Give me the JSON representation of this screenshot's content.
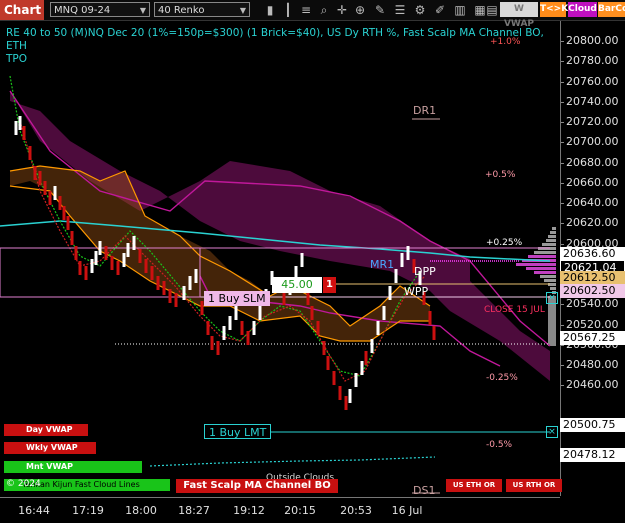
{
  "toolbar": {
    "tab_label": "Chart",
    "instrument": "MNQ 09-24",
    "bar_type": "40 Renko",
    "buttons": {
      "vwap": "W VWAP",
      "tk": "T<>K",
      "cloud": "Cloud",
      "barco": "BarCo"
    },
    "icons": [
      "bar-chart-icon",
      "candle-icon",
      "bar-type-icon",
      "magnify-icon",
      "crosshair-icon",
      "zoom-icon",
      "draw-icon",
      "properties-icon",
      "strategy-icon",
      "pencil-icon",
      "bars-icon",
      "chart-trader-icon",
      "grid-icon"
    ]
  },
  "chart": {
    "title": "RE 40 to 50 (M)NQ Dec 20 (1%=150p=$300) (1 Brick=$40), US Dy RTH %, Fast Scalp MA Channel BO, ETH",
    "subtitle": "TPO",
    "colors": {
      "up": "#ffffff",
      "down": "#cc1010",
      "ma_orange": "#ff9900",
      "cloud_magenta": "#c0189a",
      "ma_cyan": "#2ad2d2",
      "ma_green": "#19c419"
    }
  },
  "price_axis": {
    "ticks": [
      "20800.00",
      "20780.00",
      "20760.00",
      "20740.00",
      "20720.00",
      "20700.00",
      "20680.00",
      "20660.00",
      "20640.00",
      "20620.00",
      "20600.00",
      "20580.00",
      "20560.00",
      "20540.00",
      "20520.00",
      "20500.00",
      "20480.00",
      "20460.00"
    ],
    "tags": [
      {
        "name": "tag-20636",
        "text": "20636.60",
        "fg": "#000",
        "bg": "#ffffff"
      },
      {
        "name": "tag-20621",
        "text": "20621.04",
        "fg": "#fff",
        "bg": "#000"
      },
      {
        "name": "tag-20612",
        "text": "20612.50",
        "fg": "#000",
        "bg": "#e8c070"
      },
      {
        "name": "tag-20602",
        "text": "20602.50",
        "fg": "#000",
        "bg": "#f0c8e8"
      },
      {
        "name": "tag-20567",
        "text": "20567.25",
        "fg": "#000",
        "bg": "#ffffff"
      },
      {
        "name": "tag-20500",
        "text": "20500.75",
        "fg": "#000",
        "bg": "#ffffff"
      },
      {
        "name": "tag-20478",
        "text": "20478.12",
        "fg": "#000",
        "bg": "#ffffff"
      }
    ]
  },
  "time_axis": [
    "16:44",
    "17:19",
    "18:00",
    "18:27",
    "19:12",
    "20:15",
    "20:53",
    "16 Jul"
  ],
  "annotations": {
    "pct_plus1": "+1.0%",
    "pct_plus05": "+0.5%",
    "pct_plus025": "+0.25%",
    "pct_minus025": "-0.25%",
    "pct_minus05": "-0.5%",
    "dr1": "DR1",
    "mr1": "MR1",
    "dpp": "DPP",
    "wpp": "WPP",
    "close": "CLOSE 15 JUL",
    "ds1": "DS1"
  },
  "orders": {
    "buy_slm": "1 Buy SLM",
    "buy_lmt": "1 Buy LMT",
    "qty_price": "45.00",
    "qty_badge": "1"
  },
  "legend": {
    "day_vwap": "Day VWAP",
    "wkly_vwap": "Wkly VWAP",
    "mnt_vwap": "Mnt VWAP",
    "tenkan_kijun": "Tenkan Kijun Fast Cloud Lines",
    "copyright": "© 2024",
    "outside_clouds": "Outside Clouds",
    "fast_scalp": "Fast Scalp MA Channel BO",
    "us_eth_or": "US ETH OR",
    "us_rth_or": "US RTH OR"
  }
}
